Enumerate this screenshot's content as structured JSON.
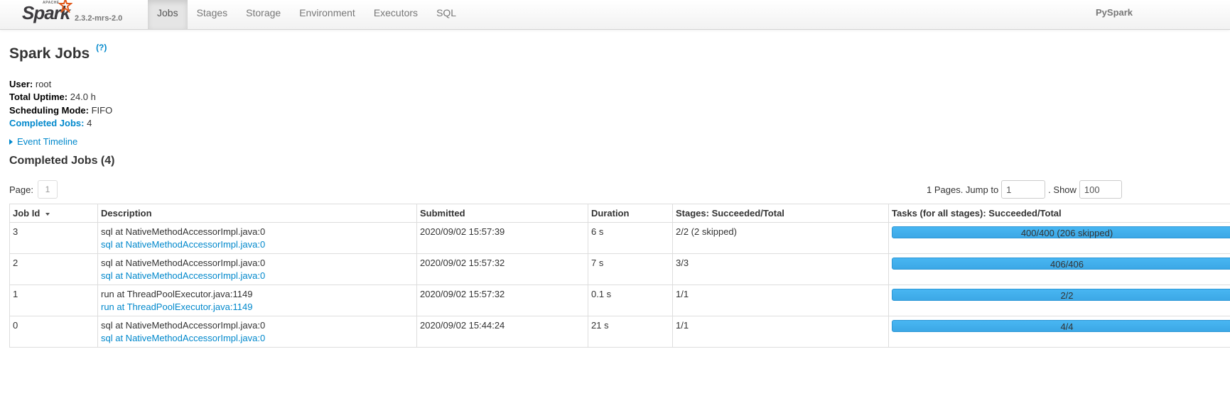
{
  "brand": {
    "apache": "APACHE",
    "name": "Spark",
    "version": "2.3.2-mrs-2.0"
  },
  "nav": {
    "items": [
      {
        "label": "Jobs",
        "active": true
      },
      {
        "label": "Stages"
      },
      {
        "label": "Storage"
      },
      {
        "label": "Environment"
      },
      {
        "label": "Executors"
      },
      {
        "label": "SQL"
      }
    ],
    "app_name": "PySpark"
  },
  "page": {
    "title": "Spark Jobs",
    "help": "(?)"
  },
  "summary": {
    "user_label": "User:",
    "user": "root",
    "uptime_label": "Total Uptime:",
    "uptime": "24.0 h",
    "mode_label": "Scheduling Mode:",
    "mode": "FIFO",
    "completed_label": "Completed Jobs:",
    "completed": "4"
  },
  "timeline": {
    "label": "Event Timeline"
  },
  "section": {
    "title": "Completed Jobs (4)"
  },
  "pager": {
    "page_label": "Page:",
    "page": "1",
    "pages_text": "1 Pages. Jump to",
    "jump_value": "1",
    "show_label": ". Show",
    "show_value": "100"
  },
  "table": {
    "headers": [
      "Job Id",
      "Description",
      "Submitted",
      "Duration",
      "Stages: Succeeded/Total",
      "Tasks (for all stages): Succeeded/Total"
    ],
    "rows": [
      {
        "id": "3",
        "desc": "sql at NativeMethodAccessorImpl.java:0",
        "desc_link": "sql at NativeMethodAccessorImpl.java:0",
        "submitted": "2020/09/02 15:57:39",
        "duration": "6 s",
        "stages": "2/2 (2 skipped)",
        "tasks": "400/400 (206 skipped)",
        "progress": 1.0
      },
      {
        "id": "2",
        "desc": "sql at NativeMethodAccessorImpl.java:0",
        "desc_link": "sql at NativeMethodAccessorImpl.java:0",
        "submitted": "2020/09/02 15:57:32",
        "duration": "7 s",
        "stages": "3/3",
        "tasks": "406/406",
        "progress": 1.0
      },
      {
        "id": "1",
        "desc": "run at ThreadPoolExecutor.java:1149",
        "desc_link": "run at ThreadPoolExecutor.java:1149",
        "submitted": "2020/09/02 15:57:32",
        "duration": "0.1 s",
        "stages": "1/1",
        "tasks": "2/2",
        "progress": 1.0
      },
      {
        "id": "0",
        "desc": "sql at NativeMethodAccessorImpl.java:0",
        "desc_link": "sql at NativeMethodAccessorImpl.java:0",
        "submitted": "2020/09/02 15:44:24",
        "duration": "21 s",
        "stages": "1/1",
        "tasks": "4/4",
        "progress": 1.0
      }
    ]
  },
  "colors": {
    "link": "#0088cc",
    "progress": "#3ca8e6",
    "navbar": "#f2f2f2"
  }
}
